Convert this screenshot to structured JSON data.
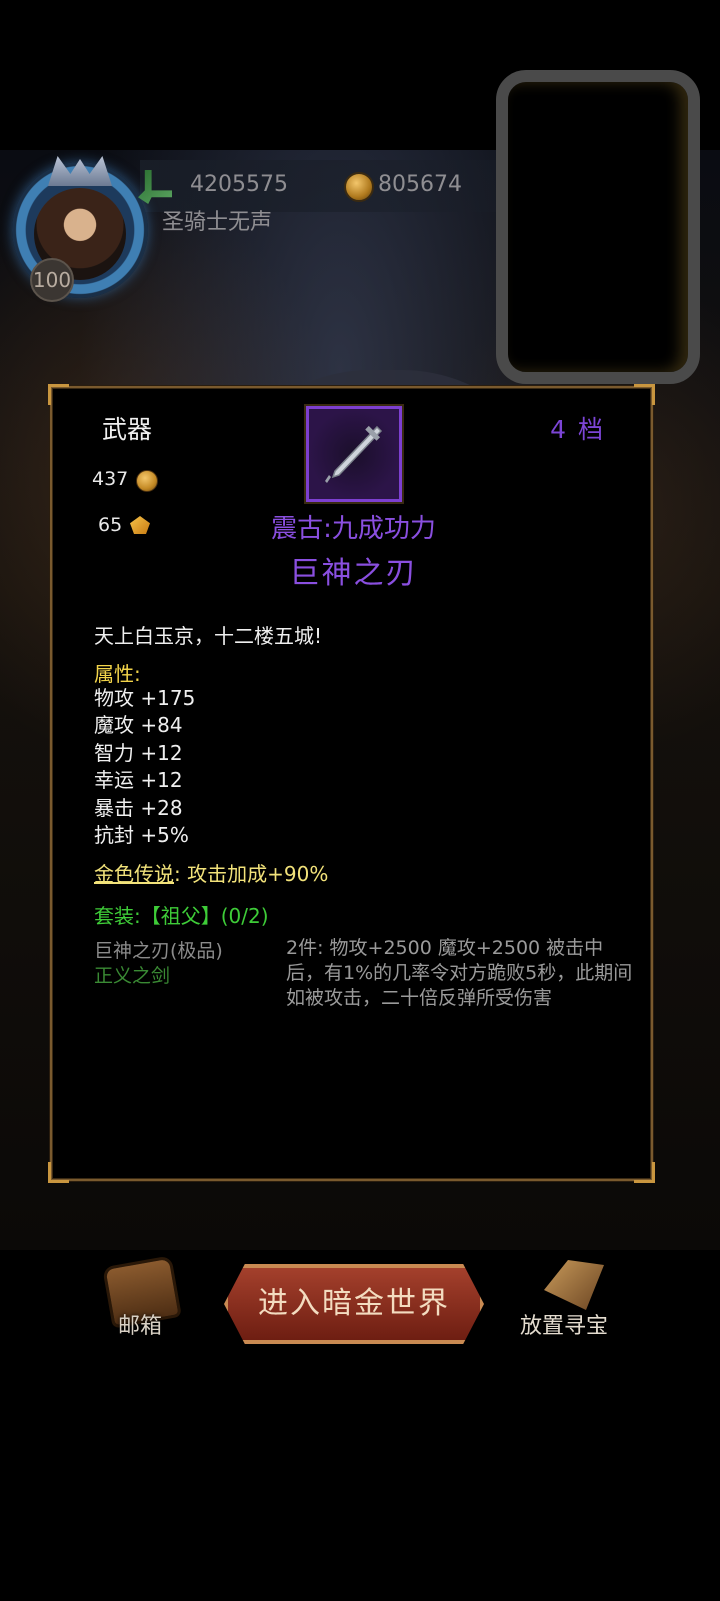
{
  "hud": {
    "power": "4205575",
    "gold": "805674",
    "player_name": "圣骑士无声",
    "level": "100"
  },
  "item": {
    "category": "武器",
    "tier": "4 档",
    "price_gold": "437",
    "price_gem": "65",
    "prefix": "震古:九成功力",
    "name": "巨神之刃",
    "flavor": "天上白玉京，十二楼五城!",
    "attr_title": "属性:",
    "attributes": [
      "物攻 +175",
      "魔攻 +84",
      "智力 +12",
      "幸运 +12",
      "暴击 +28",
      "抗封 +5%"
    ],
    "legend_label": "金色传说",
    "legend_colon": ":",
    "legend_value": "攻击加成+90%",
    "set_title": "套装:【祖父】(0/2)",
    "set_pieces": [
      "巨神之刃(极品)",
      "正义之剑"
    ],
    "set_bonus": "2件: 物攻+2500 魔攻+2500 被击中后，有1%的几率令对方跪败5秒，此期间如被攻击，二十倍反弹所受伤害"
  },
  "bottom": {
    "mail_label": "邮箱",
    "enter_label": "进入暗金世界",
    "treasure_label": "放置寻宝"
  },
  "colors": {
    "epic": "#8a4fe0",
    "attr_title": "#f2d44a",
    "set_green": "#3ecc38",
    "frame_gold": "#c9963f"
  },
  "icons": [
    "power-icon",
    "gold-coin-icon",
    "gem-icon",
    "sword-icon",
    "mail-chest-icon",
    "treasure-icon"
  ]
}
